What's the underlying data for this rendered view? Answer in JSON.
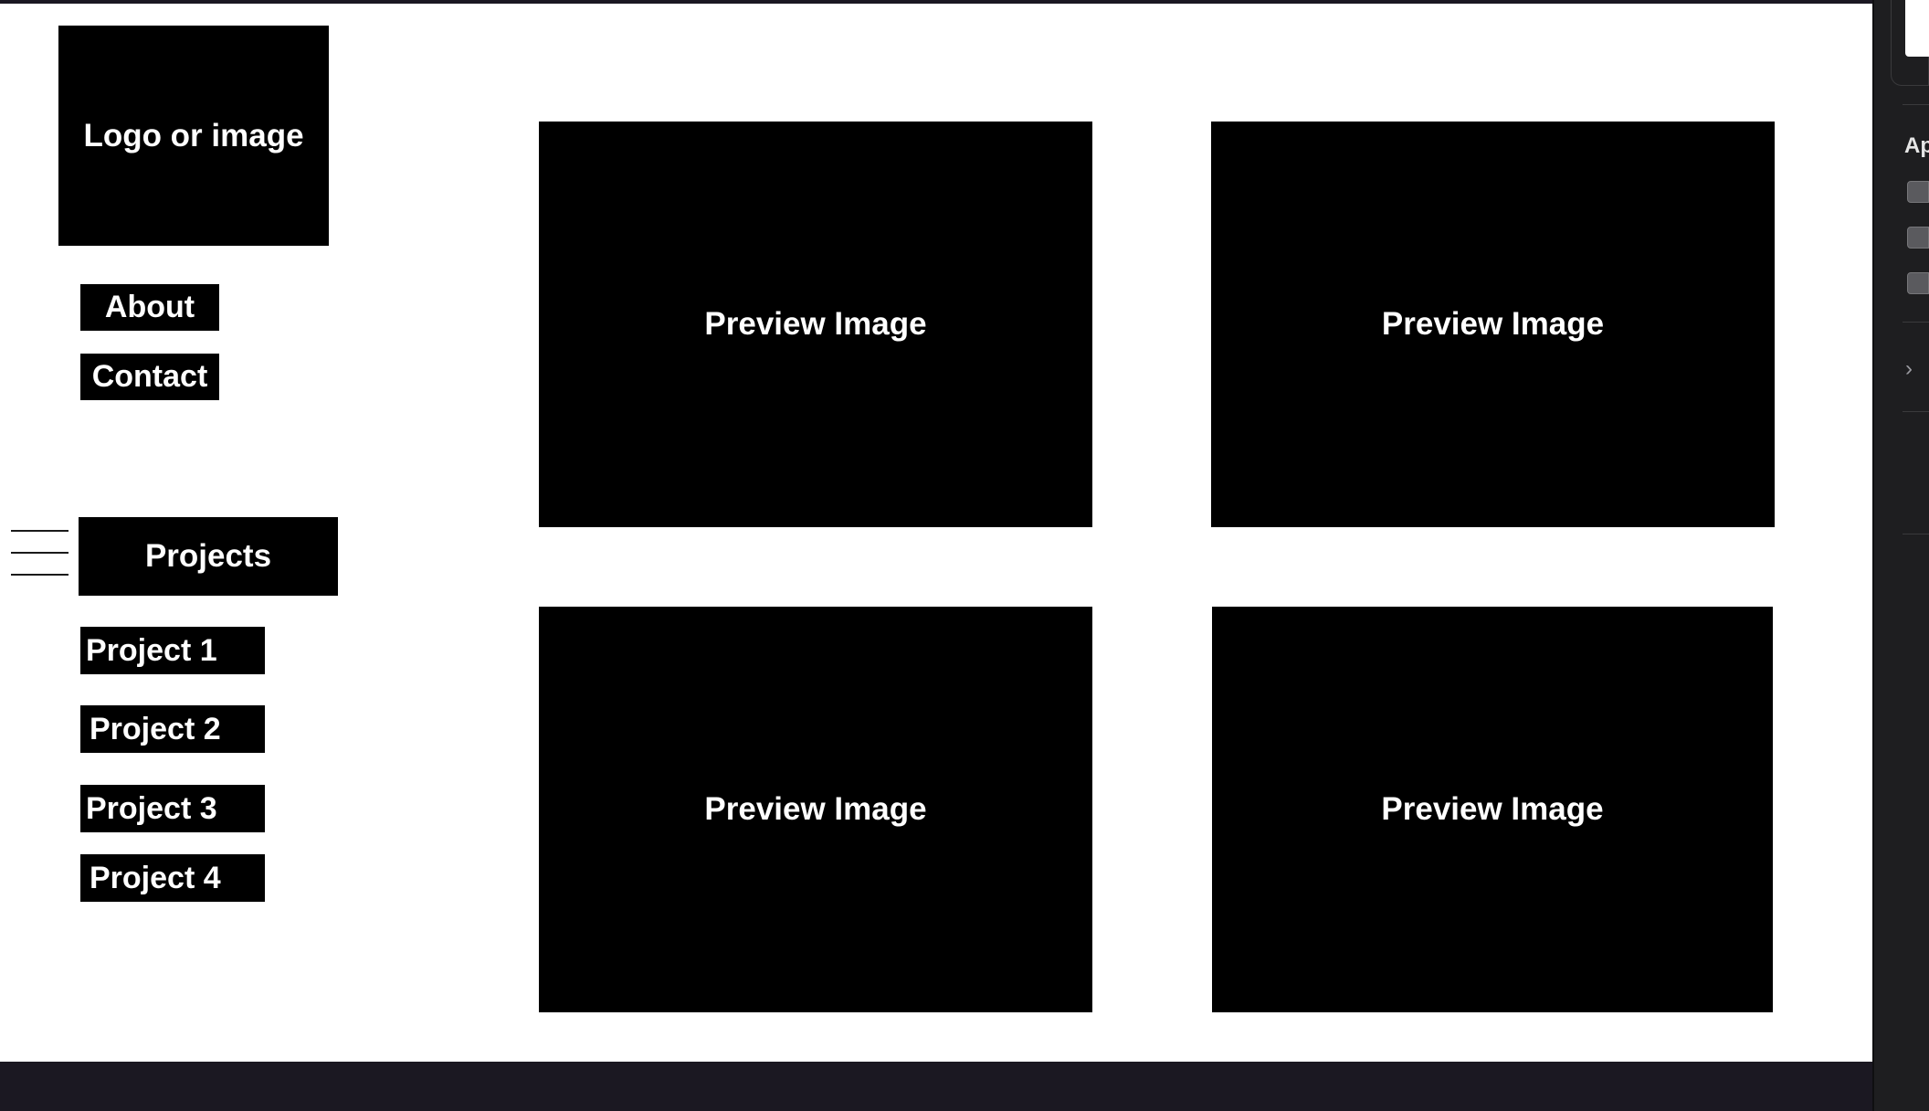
{
  "sidebar": {
    "logo_text": "Logo or image",
    "nav_items": [
      "About",
      "Contact"
    ],
    "projects_label": "Projects",
    "project_items": [
      "Project 1",
      "Project 2",
      "Project 3",
      "Project 4"
    ]
  },
  "main": {
    "preview_tiles": [
      "Preview Image",
      "Preview Image",
      "Preview Image",
      "Preview Image"
    ]
  },
  "inspector": {
    "section_label": "Ap",
    "chevron": "›",
    "toggle_count": 3
  },
  "icons": {
    "hamburger": "hamburger-menu-icon",
    "chevron": "chevron-right-icon"
  },
  "colors": {
    "canvas": "#ffffff",
    "block": "#000000",
    "block_text": "#ffffff",
    "chrome": "#1b1822"
  }
}
